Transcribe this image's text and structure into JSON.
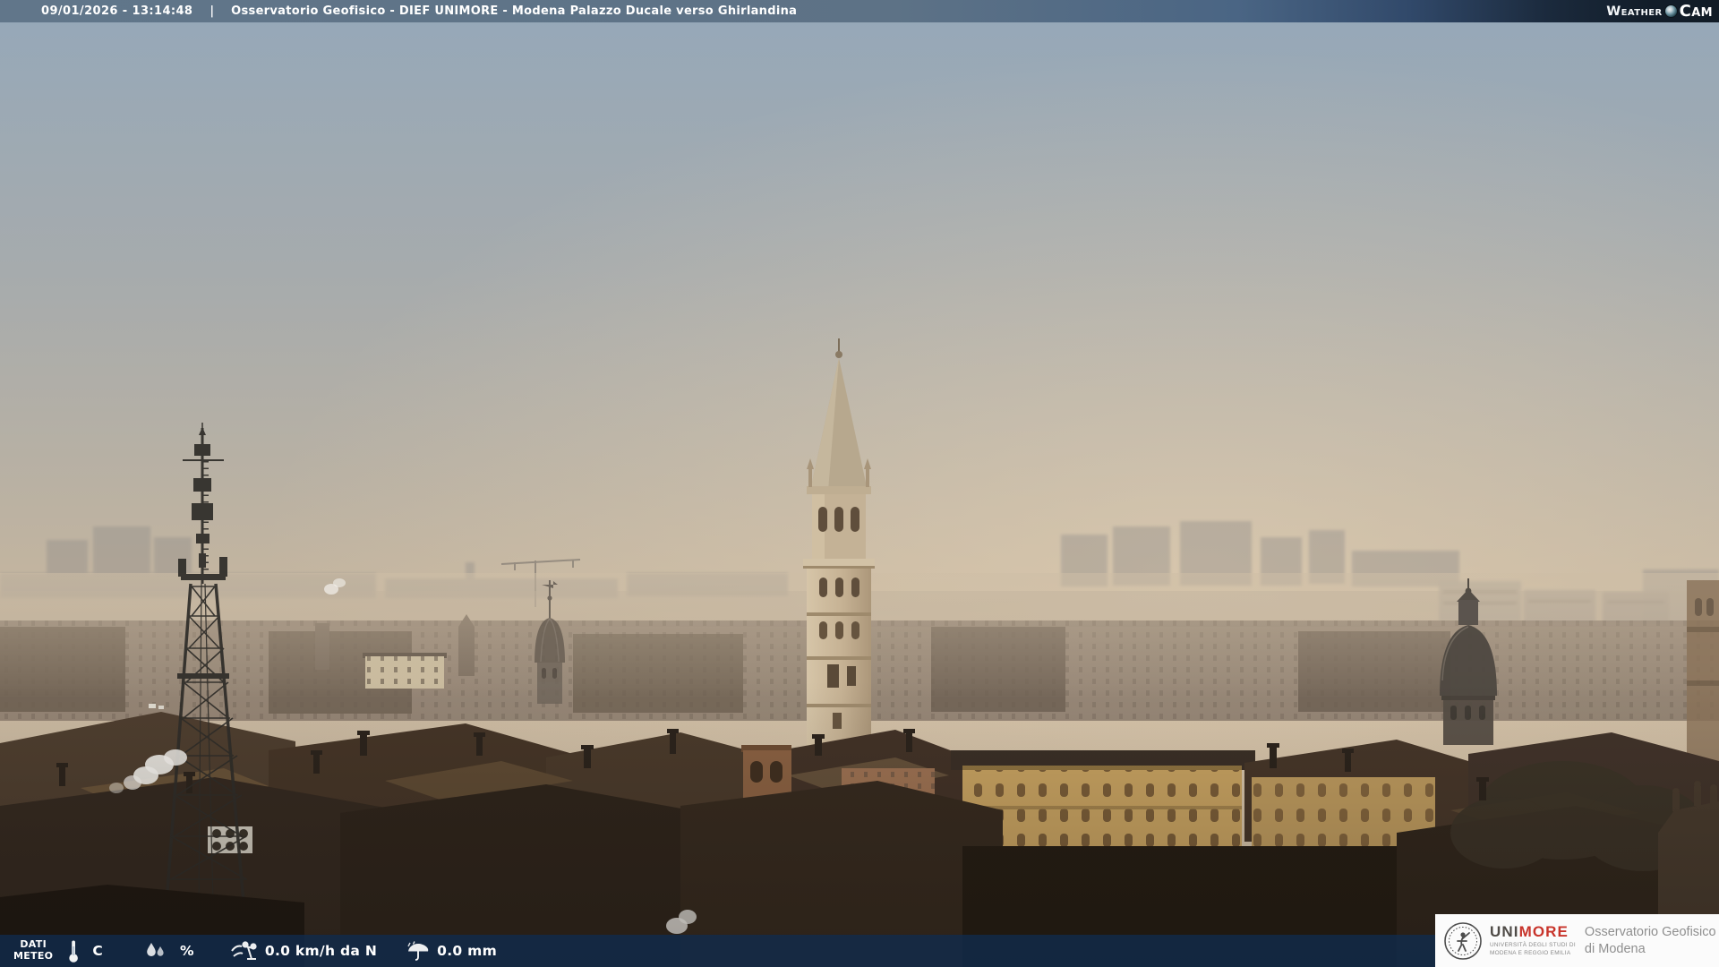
{
  "header": {
    "timestamp": "09/01/2026 - 13:14:48",
    "separator": "|",
    "title": "Osservatorio Geofisico - DIEF UNIMORE - Modena Palazzo Ducale verso Ghirlandina",
    "brand": {
      "weather": "Weather",
      "cam": "Cam"
    }
  },
  "footer": {
    "label_line1": "DATI",
    "label_line2": "METEO",
    "temperature": {
      "value": "",
      "unit": "C"
    },
    "humidity": {
      "value": "",
      "unit": "%"
    },
    "wind_value": "0.0 km/h da N",
    "rain_value": "0.0 mm"
  },
  "logo_box": {
    "acronym_uni": "UNI",
    "acronym_more": "MORE",
    "university_line1": "UNIVERSITÀ DEGLI STUDI DI",
    "university_line2": "MODENA E REGGIO EMILIA",
    "org_line1": "Osservatorio Geofisico",
    "org_line2": "di Modena"
  },
  "icons": {
    "temperature": "thermometer-icon",
    "humidity": "water-drops-icon",
    "wind": "anemometer-icon",
    "rain": "umbrella-icon",
    "brand_lens": "camera-lens-icon",
    "crest": "unimore-crest-icon"
  },
  "colors": {
    "header_bar_left": "#5e7487",
    "header_bar_right": "#131f2b",
    "footer_bar": "rgba(15,44,78,0.78)",
    "brand_red": "#c8342b",
    "sky_top": "#97a9b9",
    "sky_horizon": "#cbb9a1"
  }
}
